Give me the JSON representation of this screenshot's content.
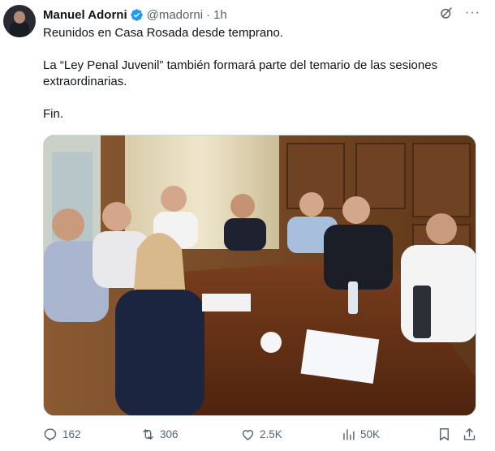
{
  "author": {
    "name": "Manuel Adorni",
    "handle": "@madorni",
    "separator": "·",
    "time": "1h"
  },
  "top_icons": {
    "grok": "grok-icon",
    "more": "···"
  },
  "body": {
    "line1": "Reunidos en Casa Rosada desde temprano.",
    "line2": "La “Ley Penal Juvenil” también formará parte del temario de las sesiones extraordinarias.",
    "line3": "Fin."
  },
  "actions": {
    "replies": "162",
    "reposts": "306",
    "likes": "2.5K",
    "views": "50K"
  },
  "colors": {
    "verified": "#1d9bf0",
    "muted": "#536471",
    "text": "#0f1419"
  }
}
